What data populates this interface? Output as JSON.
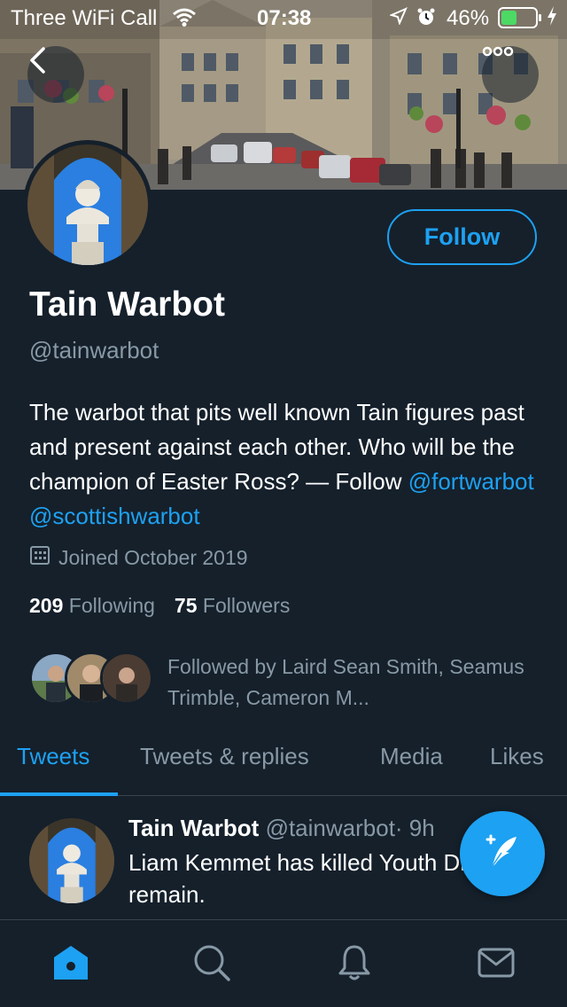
{
  "status_bar": {
    "carrier": "Three WiFi Call",
    "time": "07:38",
    "battery_percent": "46%",
    "battery_level": 0.46,
    "icons": [
      "wifi-icon",
      "location-arrow-icon",
      "alarm-icon",
      "battery-icon",
      "charging-bolt-icon"
    ]
  },
  "header": {
    "back_icon": "chevron-left-icon",
    "more_icon": "more-dots-icon"
  },
  "profile": {
    "follow_label": "Follow",
    "display_name": "Tain Warbot",
    "handle": "@tainwarbot",
    "bio_text": "The warbot that pits well known Tain figures past and present against each other. Who will be the champion of Easter Ross? — Follow ",
    "bio_link_1": "@fortwarbot",
    "bio_link_2": "@scottishwarbot",
    "joined": "Joined October 2019",
    "following_count": "209",
    "following_label": "Following",
    "followers_count": "75",
    "followers_label": "Followers",
    "followed_by_text": "Followed by Laird Sean Smith, Seamus Trimble, Cameron M..."
  },
  "tabs": [
    {
      "label": "Tweets",
      "active": true
    },
    {
      "label": "Tweets & replies",
      "active": false
    },
    {
      "label": "Media",
      "active": false
    },
    {
      "label": "Likes",
      "active": false
    }
  ],
  "tweet": {
    "name": "Tain Warbot",
    "handle": "@tainwarbot",
    "time": "· 9h",
    "text": "Liam Kemmet has killed Youth Drew. 31 remain."
  },
  "bottom_nav": [
    {
      "icon": "home-icon",
      "active": true
    },
    {
      "icon": "search-icon",
      "active": false
    },
    {
      "icon": "bell-icon",
      "active": false
    },
    {
      "icon": "mail-icon",
      "active": false
    }
  ],
  "colors": {
    "background": "#15202b",
    "accent": "#1da1f2",
    "secondary_text": "#8899a6",
    "divider": "#38444d"
  }
}
